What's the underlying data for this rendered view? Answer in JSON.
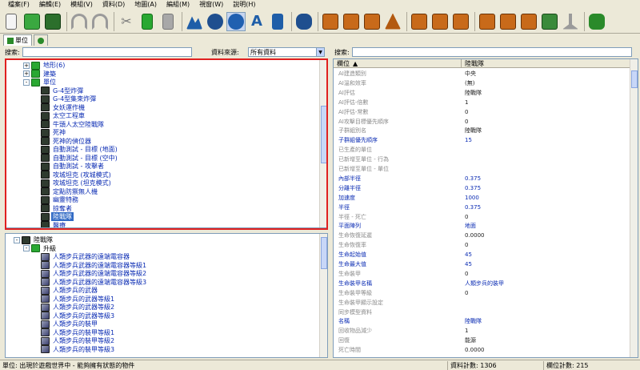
{
  "menu": [
    "檔案(F)",
    "編輯(E)",
    "模組(V)",
    "資料(D)",
    "地圖(A)",
    "編組(M)",
    "視窗(W)",
    "說明(H)"
  ],
  "tabs": [
    {
      "label": "單位"
    },
    {
      "label": ""
    }
  ],
  "search": {
    "label": "搜索:",
    "value": ""
  },
  "source": {
    "label": "資料來源:",
    "value": "所有資料"
  },
  "right_search": {
    "label": "搜索:",
    "value": ""
  },
  "tree_top": [
    {
      "label": "地形(6)",
      "level": 1,
      "exp": "+",
      "icon": "folder"
    },
    {
      "label": "建築",
      "level": 1,
      "exp": "+",
      "icon": "folder"
    },
    {
      "label": "單位",
      "level": 1,
      "exp": "-",
      "icon": "folder"
    },
    {
      "label": "G-4型炸彈",
      "level": 2,
      "icon": "unit"
    },
    {
      "label": "G-4型集束炸彈",
      "level": 2,
      "icon": "unit"
    },
    {
      "label": "女妖運作機",
      "level": 2,
      "icon": "unit"
    },
    {
      "label": "太空工程車",
      "level": 2,
      "icon": "unit"
    },
    {
      "label": "牛頭人太空陸戰隊",
      "level": 2,
      "icon": "unit"
    },
    {
      "label": "死神",
      "level": 2,
      "icon": "unit"
    },
    {
      "label": "死神的偵位器",
      "level": 2,
      "icon": "unit"
    },
    {
      "label": "自動測試 - 目標 (地面)",
      "level": 2,
      "icon": "unit"
    },
    {
      "label": "自動測試 - 目標 (空中)",
      "level": 2,
      "icon": "unit"
    },
    {
      "label": "自動測試 - 攻擊者",
      "level": 2,
      "icon": "unit"
    },
    {
      "label": "攻城坦克 (攻城模式)",
      "level": 2,
      "icon": "unit"
    },
    {
      "label": "攻城坦克 (坦克模式)",
      "level": 2,
      "icon": "unit"
    },
    {
      "label": "定點防禦無人機",
      "level": 2,
      "icon": "unit"
    },
    {
      "label": "幽靈特務",
      "level": 2,
      "icon": "unit"
    },
    {
      "label": "掠奪者",
      "level": 2,
      "icon": "unit"
    },
    {
      "label": "陸戰隊",
      "level": 2,
      "icon": "unit",
      "selected": true
    },
    {
      "label": "醫療",
      "level": 2,
      "icon": "unit"
    }
  ],
  "tree_bottom": [
    {
      "label": "陸戰隊",
      "level": 0,
      "exp": "-",
      "icon": "unit",
      "black": true
    },
    {
      "label": "升級",
      "level": 1,
      "exp": "-",
      "icon": "folder",
      "black": true
    },
    {
      "label": "人類步兵武器的遠端電容器",
      "level": 2,
      "icon": "up"
    },
    {
      "label": "人類步兵武器的遠端電容器等級1",
      "level": 2,
      "icon": "up"
    },
    {
      "label": "人類步兵武器的遠端電容器等級2",
      "level": 2,
      "icon": "up"
    },
    {
      "label": "人類步兵武器的遠端電容器等級3",
      "level": 2,
      "icon": "up"
    },
    {
      "label": "人類步兵的武器",
      "level": 2,
      "icon": "up"
    },
    {
      "label": "人類步兵的武器等級1",
      "level": 2,
      "icon": "up"
    },
    {
      "label": "人類步兵的武器等級2",
      "level": 2,
      "icon": "up"
    },
    {
      "label": "人類步兵的武器等級3",
      "level": 2,
      "icon": "up"
    },
    {
      "label": "人類步兵的裝甲",
      "level": 2,
      "icon": "up"
    },
    {
      "label": "人類步兵的裝甲等級1",
      "level": 2,
      "icon": "up"
    },
    {
      "label": "人類步兵的裝甲等級2",
      "level": 2,
      "icon": "up"
    },
    {
      "label": "人類步兵的裝甲等級3",
      "level": 2,
      "icon": "up"
    }
  ],
  "grid": {
    "col_field": "欄位",
    "col_value": "陸戰隊",
    "rows": [
      {
        "n": "AI建造類別",
        "v": "中央",
        "b": false
      },
      {
        "n": "AI溫和效率",
        "v": "(無)",
        "b": false
      },
      {
        "n": "AI評估",
        "v": "陸戰隊",
        "b": false
      },
      {
        "n": "AI評估-倍數",
        "v": "1",
        "b": false
      },
      {
        "n": "AI評估-常數",
        "v": "0",
        "b": false
      },
      {
        "n": "AI攻擊目標優先順序",
        "v": "0",
        "b": false
      },
      {
        "n": "子群組別名",
        "v": "陸戰隊",
        "b": false
      },
      {
        "n": "子群組優先順序",
        "v": "15",
        "b": true
      },
      {
        "n": "已生產的單位",
        "v": "",
        "b": false
      },
      {
        "n": "已新增至單位 - 行為",
        "v": "",
        "b": false
      },
      {
        "n": "已新增至單位 - 單位",
        "v": "",
        "b": false
      },
      {
        "n": "內部半徑",
        "v": "0.375",
        "b": true
      },
      {
        "n": "分離半徑",
        "v": "0.375",
        "b": true
      },
      {
        "n": "加速度",
        "v": "1000",
        "b": true
      },
      {
        "n": "半徑",
        "v": "0.375",
        "b": true
      },
      {
        "n": "半徑 - 死亡",
        "v": "0",
        "b": false
      },
      {
        "n": "平面陣列",
        "v": "地面",
        "b": true
      },
      {
        "n": "生命恢復延遲",
        "v": "0.0000",
        "b": false
      },
      {
        "n": "生命恢復率",
        "v": "0",
        "b": false
      },
      {
        "n": "生命起始值",
        "v": "45",
        "b": true
      },
      {
        "n": "生命最大值",
        "v": "45",
        "b": true
      },
      {
        "n": "生命裝甲",
        "v": "0",
        "b": false
      },
      {
        "n": "生命裝甲名稱",
        "v": "人類步兵的裝甲",
        "b": true
      },
      {
        "n": "生命裝甲等級",
        "v": "0",
        "b": false
      },
      {
        "n": "生命裝甲顯示設定",
        "v": "",
        "b": false
      },
      {
        "n": "同步模型資料",
        "v": "",
        "b": false
      },
      {
        "n": "名稱",
        "v": "陸戰隊",
        "b": true
      },
      {
        "n": "回收物品減少",
        "v": "1",
        "b": false
      },
      {
        "n": "回復",
        "v": "能源",
        "b": false
      },
      {
        "n": "死亡時間",
        "v": "0.0000",
        "b": false
      }
    ]
  },
  "status": {
    "message": "單位: 出現於遊戲世界中 - 能夠擁有狀態的物件",
    "records": "資料計數: 1306",
    "fields": "欄位計數: 215"
  }
}
